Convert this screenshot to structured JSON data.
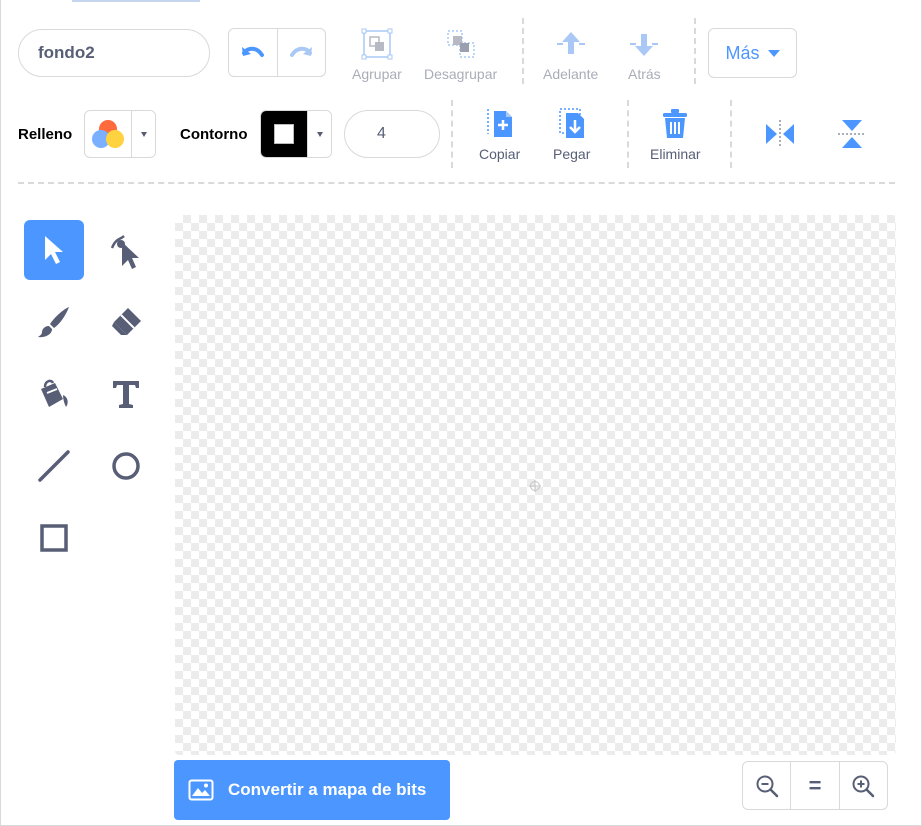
{
  "costume": {
    "name": "fondo2"
  },
  "toolbar": {
    "group_label": "Agrupar",
    "ungroup_label": "Desagrupar",
    "forward_label": "Adelante",
    "backward_label": "Atrás",
    "more_label": "Más",
    "fill_label": "Relleno",
    "outline_label": "Contorno",
    "stroke_width": "4",
    "copy_label": "Copiar",
    "paste_label": "Pegar",
    "delete_label": "Eliminar"
  },
  "tools": [
    {
      "name": "select-tool",
      "icon": "arrow-cursor-icon",
      "active": true
    },
    {
      "name": "reshape-tool",
      "icon": "reshape-cursor-icon",
      "active": false
    },
    {
      "name": "brush-tool",
      "icon": "brush-icon",
      "active": false
    },
    {
      "name": "eraser-tool",
      "icon": "eraser-icon",
      "active": false
    },
    {
      "name": "fill-tool",
      "icon": "paint-bucket-icon",
      "active": false
    },
    {
      "name": "text-tool",
      "icon": "text-t-icon",
      "active": false
    },
    {
      "name": "line-tool",
      "icon": "line-icon",
      "active": false
    },
    {
      "name": "circle-tool",
      "icon": "circle-icon",
      "active": false
    },
    {
      "name": "rectangle-tool",
      "icon": "square-icon",
      "active": false
    }
  ],
  "footer": {
    "convert_label": "Convertir a mapa de bits",
    "zoom_equal_label": "="
  },
  "colors": {
    "accent": "#4c97ff",
    "text": "#575e75",
    "border": "#d9d9d9",
    "outline_color": "#000000"
  }
}
